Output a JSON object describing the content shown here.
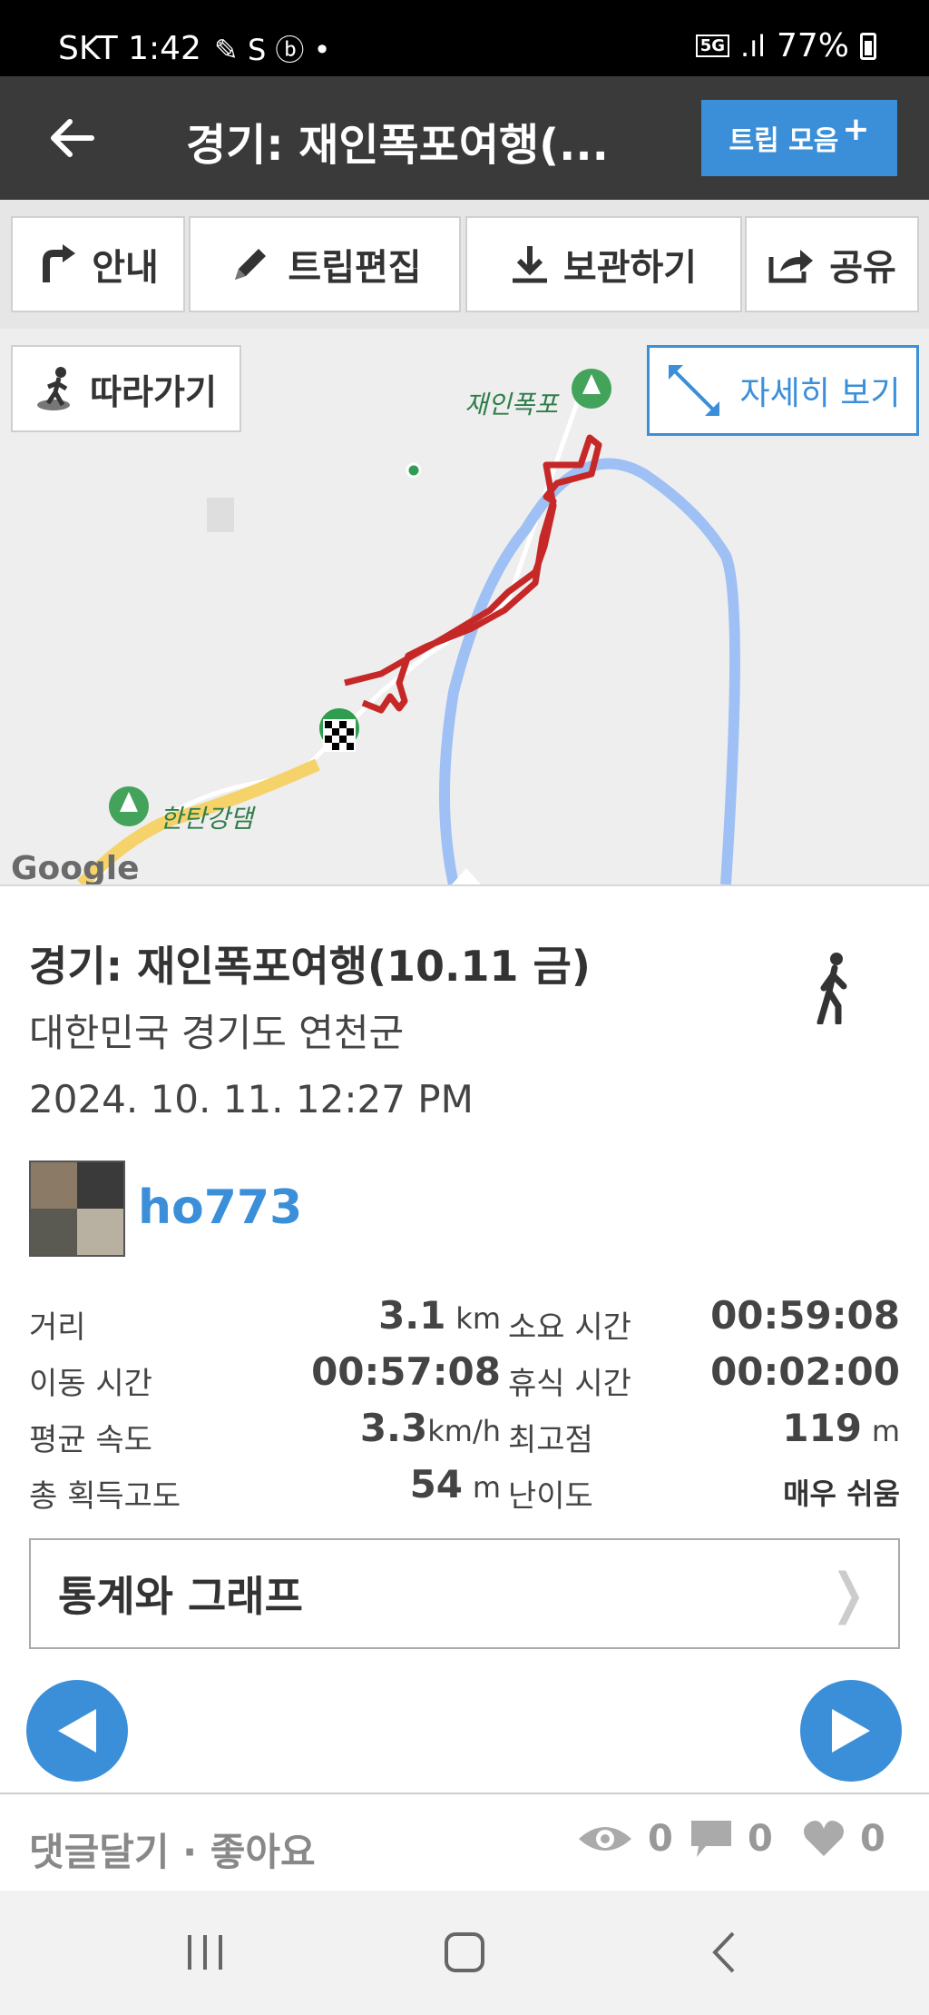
{
  "status_bar": {
    "carrier_time": "SKT 1:42",
    "network": "5G",
    "battery": "77%"
  },
  "header": {
    "title": "경기: 재인폭포여행(...",
    "trip_collection_label": "트립 모음",
    "trip_collection_plus": "+"
  },
  "toolbar": {
    "guide": "안내",
    "edit": "트립편집",
    "save": "보관하기",
    "share": "공유"
  },
  "map": {
    "follow_label": "따라가기",
    "detail_label": "자세히 보기",
    "poi_waterfall": "재인폭포",
    "poi_dam": "한탄강댐",
    "google": "Google"
  },
  "trip": {
    "title": "경기: 재인폭포여행(10.11 금)",
    "location": "대한민국 경기도 연천군",
    "datetime": "2024. 10. 11. 12:27 PM",
    "username": "ho773"
  },
  "stats": {
    "distance_label": "거리",
    "distance_value": "3.1",
    "distance_unit": "km",
    "duration_label": "소요 시간",
    "duration_value": "00:59:08",
    "moving_label": "이동 시간",
    "moving_value": "00:57:08",
    "rest_label": "휴식 시간",
    "rest_value": "00:02:00",
    "avg_speed_label": "평균 속도",
    "avg_speed_value": "3.3",
    "avg_speed_unit": "km/h",
    "max_alt_label": "최고점",
    "max_alt_value": "119",
    "max_alt_unit": "m",
    "gain_label": "총 획득고도",
    "gain_value": "54",
    "gain_unit": "m",
    "difficulty_label": "난이도",
    "difficulty_value": "매우 쉬움"
  },
  "stats_graph_label": "통계와 그래프",
  "footer": {
    "comments_like": "댓글달기 · 좋아요",
    "views": "0",
    "comments": "0",
    "likes": "0"
  }
}
